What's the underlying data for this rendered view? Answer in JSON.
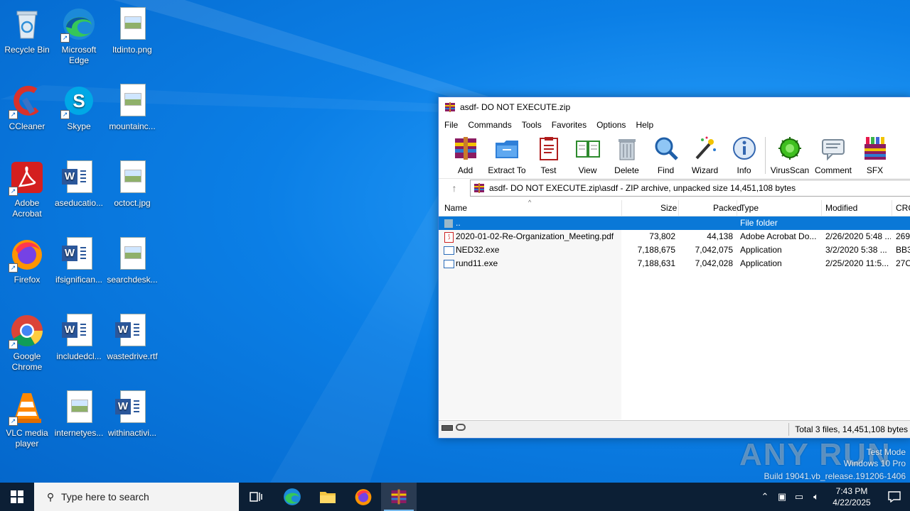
{
  "desktop": {
    "icons": [
      {
        "label": "Recycle Bin"
      },
      {
        "label": "Microsoft Edge"
      },
      {
        "label": "ltdinto.png"
      },
      {
        "label": "CCleaner"
      },
      {
        "label": "Skype"
      },
      {
        "label": "mountainc..."
      },
      {
        "label": "Adobe Acrobat"
      },
      {
        "label": "aseducatio..."
      },
      {
        "label": "octoct.jpg"
      },
      {
        "label": "Firefox"
      },
      {
        "label": "ifsignifican..."
      },
      {
        "label": "searchdesk..."
      },
      {
        "label": "Google Chrome"
      },
      {
        "label": "includedcl..."
      },
      {
        "label": "wastedrive.rtf"
      },
      {
        "label": "VLC media player"
      },
      {
        "label": "internetyes..."
      },
      {
        "label": "withinactivi..."
      }
    ]
  },
  "winrar": {
    "title": "asdf- DO NOT EXECUTE.zip",
    "menu": [
      "File",
      "Commands",
      "Tools",
      "Favorites",
      "Options",
      "Help"
    ],
    "toolbar": [
      "Add",
      "Extract To",
      "Test",
      "View",
      "Delete",
      "Find",
      "Wizard",
      "Info",
      "VirusScan",
      "Comment",
      "SFX"
    ],
    "address": "asdf- DO NOT EXECUTE.zip\\asdf - ZIP archive, unpacked size 14,451,108 bytes",
    "columns": [
      "Name",
      "Size",
      "Packed",
      "Type",
      "Modified",
      "CRC"
    ],
    "files": [
      {
        "name": "..",
        "size": "",
        "packed": "",
        "type": "File folder",
        "modified": "",
        "crc": ""
      },
      {
        "name": "2020-01-02-Re-Organization_Meeting.pdf",
        "size": "73,802",
        "packed": "44,138",
        "type": "Adobe Acrobat Do...",
        "modified": "2/26/2020 5:48 ...",
        "crc": "269"
      },
      {
        "name": "NED32.exe",
        "size": "7,188,675",
        "packed": "7,042,075",
        "type": "Application",
        "modified": "3/2/2020 5:38 ...",
        "crc": "BB3"
      },
      {
        "name": "rund11.exe",
        "size": "7,188,631",
        "packed": "7,042,028",
        "type": "Application",
        "modified": "2/25/2020 11:5...",
        "crc": "27C"
      }
    ],
    "status": "Total 3 files, 14,451,108 bytes"
  },
  "watermark": {
    "brand": "ANY RUN",
    "line1": "Test Mode",
    "line2": "Windows 10 Pro",
    "line3": "Build 19041.vb_release.191206-1406"
  },
  "taskbar": {
    "search_placeholder": "Type here to search",
    "time": "7:43 PM",
    "date": "4/22/2025"
  }
}
